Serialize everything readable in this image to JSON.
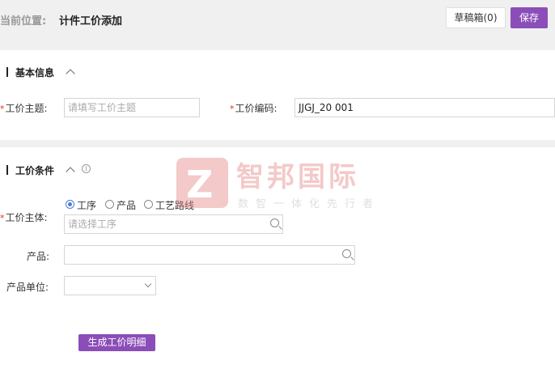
{
  "header": {
    "breadcrumb_prefix": "当前位置:",
    "breadcrumb_title": "计件工价添加",
    "draft_label": "草稿箱(0)",
    "save_label": "保存"
  },
  "basic_info": {
    "title": "基本信息",
    "subject_label": "工价主题:",
    "subject_placeholder": "请填写工价主题",
    "code_label": "工价编码:",
    "code_value": "JJGJ_20      001"
  },
  "conditions": {
    "title": "工价条件",
    "subject_label": "工价主体:",
    "radio_options": [
      "工序",
      "产品",
      "工艺路线"
    ],
    "selected_option": "工序",
    "process_placeholder": "请选择工序",
    "product_label": "产品:",
    "product_unit_label": "产品单位:",
    "generate_button": "生成工价明细"
  },
  "watermark": {
    "logo_letter": "Z",
    "name": "智邦国际",
    "slogan": "数智一体化先行者"
  },
  "colors": {
    "accent": "#8b4db8",
    "required": "#e03030",
    "radio_active": "#4a7cd8"
  }
}
